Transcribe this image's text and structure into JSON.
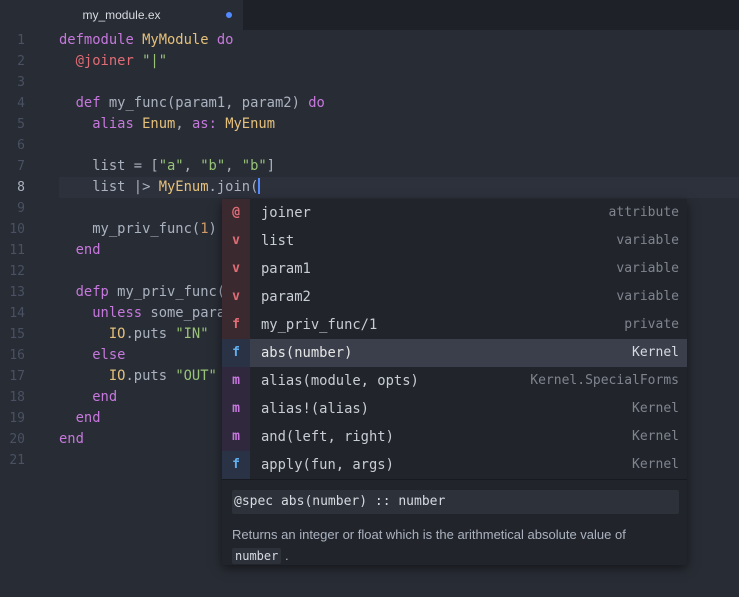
{
  "tab": {
    "filename": "my_module.ex",
    "modified_indicator": "modified-dot"
  },
  "colors": {
    "background": "#282c34",
    "keyword": "#c678dd",
    "module": "#e5c07b",
    "string": "#98c379",
    "attribute": "#e06c75",
    "cursor": "#528bff",
    "badge_variable": "#e06c75",
    "badge_function": "#61afef",
    "badge_macro": "#c678dd"
  },
  "editor": {
    "active_line": 8,
    "line_numbers": [
      "1",
      "2",
      "3",
      "4",
      "5",
      "6",
      "7",
      "8",
      "9",
      "10",
      "11",
      "12",
      "13",
      "14",
      "15",
      "16",
      "17",
      "18",
      "19",
      "20",
      "21"
    ],
    "code": {
      "l1_defmodule": "defmodule",
      "l1_name": "MyModule",
      "l1_do": "do",
      "l2_attr": "@joiner",
      "l2_str": "\"|\"",
      "l4_def": "def",
      "l4_sig": "my_func(param1, param2)",
      "l4_do": "do",
      "l5_alias": "alias",
      "l5_mod": "Enum",
      "l5_as": "as:",
      "l5_target": "MyEnum",
      "l7_pre": "list = [",
      "l7_a": "\"a\"",
      "l7_b1": "\"b\"",
      "l7_b2": "\"b\"",
      "l7_post": "]",
      "l8_pre": "list |> ",
      "l8_mod": "MyEnum",
      "l8_post": ".join(",
      "l10_call": "my_priv_func(",
      "l10_num": "1",
      "l10_post": ")",
      "l11_end": "end",
      "l13_defp": "defp",
      "l13_sig": "my_priv_func(",
      "l14_unless": "unless",
      "l14_rest": "some_para",
      "l15_io": "IO",
      "l15_puts": ".puts ",
      "l15_str": "\"IN\"",
      "l16_else": "else",
      "l17_io": "IO",
      "l17_puts": ".puts ",
      "l17_str": "\"OUT\"",
      "l18_end": "end",
      "l19_end": "end",
      "l20_end": "end"
    }
  },
  "autocomplete": {
    "suggestions": [
      {
        "badge": "@",
        "text": "joiner",
        "right": "attribute",
        "kind": "attribute"
      },
      {
        "badge": "v",
        "text": "list",
        "right": "variable",
        "kind": "variable"
      },
      {
        "badge": "v",
        "text": "param1",
        "right": "variable",
        "kind": "variable"
      },
      {
        "badge": "v",
        "text": "param2",
        "right": "variable",
        "kind": "variable"
      },
      {
        "badge": "f",
        "text": "my_priv_func/1",
        "right": "private",
        "kind": "private"
      },
      {
        "badge": "f",
        "text": "abs(number)",
        "right": "Kernel",
        "kind": "function",
        "selected": true
      },
      {
        "badge": "m",
        "text": "alias(module, opts)",
        "right": "Kernel.SpecialForms",
        "kind": "macro"
      },
      {
        "badge": "m",
        "text": "alias!(alias)",
        "right": "Kernel",
        "kind": "macro"
      },
      {
        "badge": "m",
        "text": "and(left, right)",
        "right": "Kernel",
        "kind": "macro"
      },
      {
        "badge": "f",
        "text": "apply(fun, args)",
        "right": "Kernel",
        "kind": "function"
      }
    ],
    "docs": {
      "spec": "@spec abs(number) :: number",
      "description": "Returns an integer or float which is the arithmetical absolute value of",
      "code_ref": "number",
      "trailing": "."
    }
  }
}
